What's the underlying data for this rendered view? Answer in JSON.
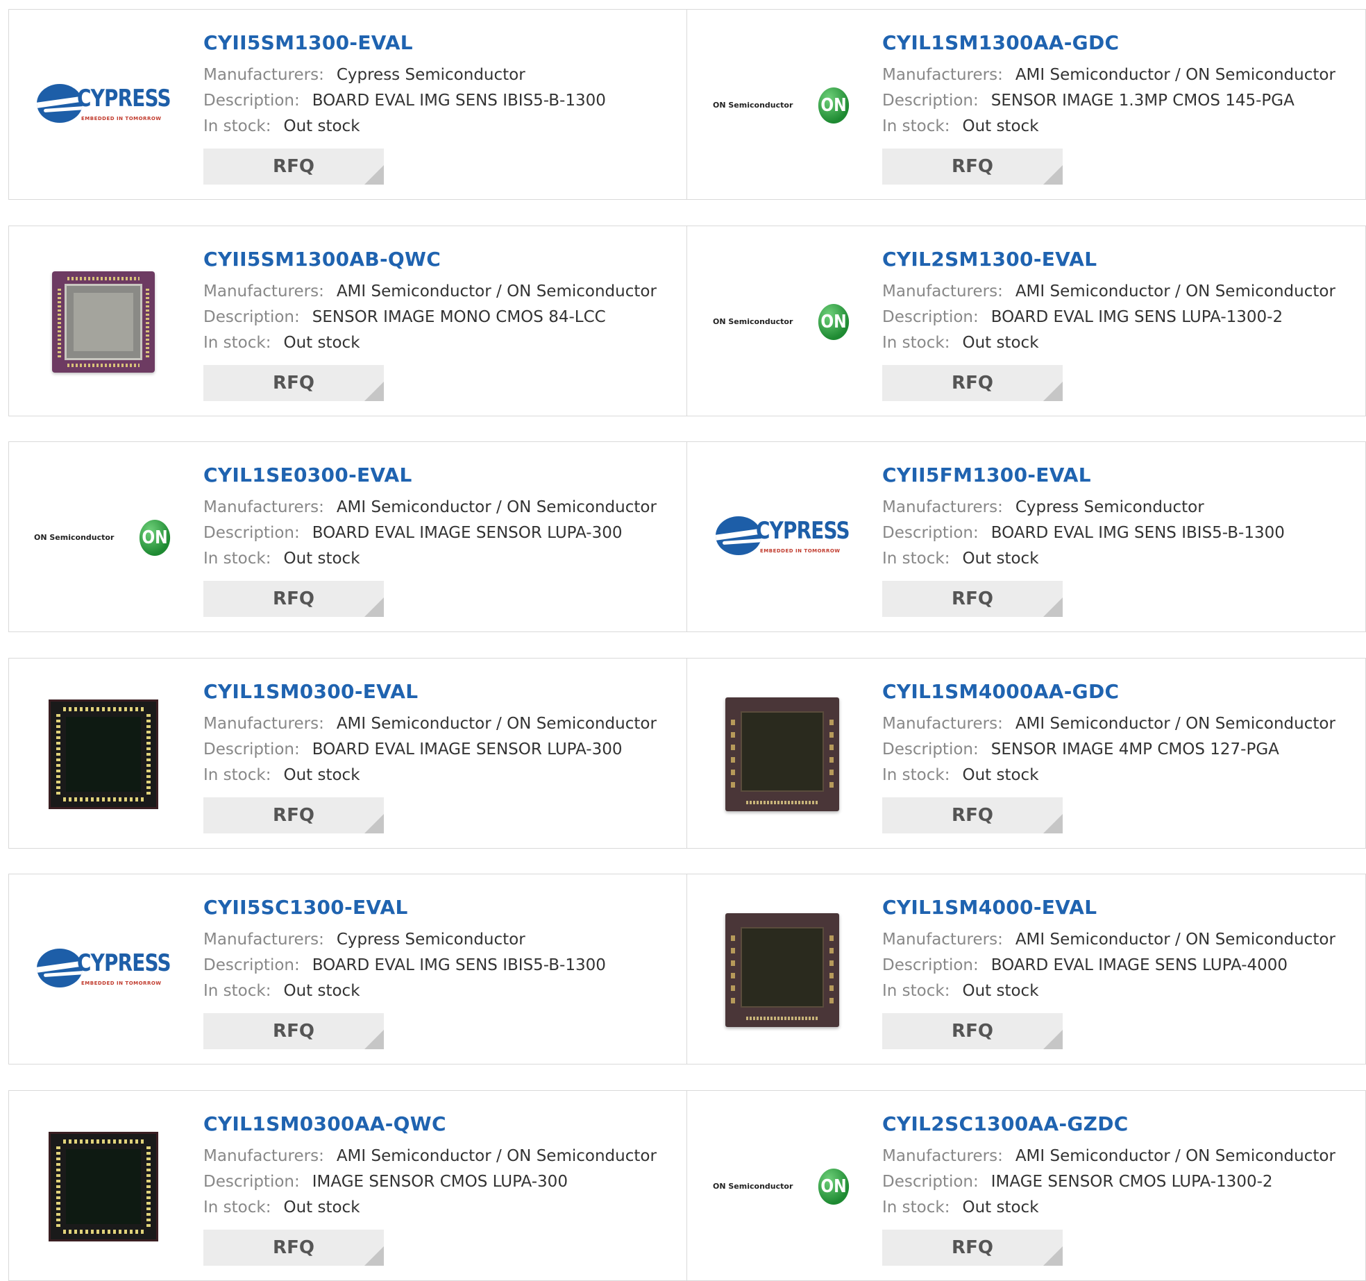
{
  "labels": {
    "manufacturers": "Manufacturers:",
    "description": "Description:",
    "in_stock": "In stock:",
    "rfq": "RFQ"
  },
  "products": [
    {
      "part": "CYII5SM1300-EVAL",
      "manufacturer": "Cypress Semiconductor",
      "description": "BOARD EVAL IMG SENS IBIS5-B-1300",
      "stock": "Out stock",
      "image": "cypress-logo"
    },
    {
      "part": "CYIL1SM1300AA-GDC",
      "manufacturer": "AMI Semiconductor / ON Semiconductor",
      "description": "SENSOR IMAGE 1.3MP CMOS 145-PGA",
      "stock": "Out stock",
      "image": "on-semiconductor-logo"
    },
    {
      "part": "CYII5SM1300AB-QWC",
      "manufacturer": "AMI Semiconductor / ON Semiconductor",
      "description": "SENSOR IMAGE MONO CMOS 84-LCC",
      "stock": "Out stock",
      "image": "purple-sensor-chip"
    },
    {
      "part": "CYIL2SM1300-EVAL",
      "manufacturer": "AMI Semiconductor / ON Semiconductor",
      "description": "BOARD EVAL IMG SENS LUPA-1300-2",
      "stock": "Out stock",
      "image": "on-semiconductor-logo"
    },
    {
      "part": "CYIL1SE0300-EVAL",
      "manufacturer": "AMI Semiconductor / ON Semiconductor",
      "description": "BOARD EVAL IMAGE SENSOR LUPA-300",
      "stock": "Out stock",
      "image": "on-semiconductor-logo"
    },
    {
      "part": "CYII5FM1300-EVAL",
      "manufacturer": "Cypress Semiconductor",
      "description": "BOARD EVAL IMG SENS IBIS5-B-1300",
      "stock": "Out stock",
      "image": "cypress-logo"
    },
    {
      "part": "CYIL1SM0300-EVAL",
      "manufacturer": "AMI Semiconductor / ON Semiconductor",
      "description": "BOARD EVAL IMAGE SENSOR LUPA-300",
      "stock": "Out stock",
      "image": "black-sensor-chip"
    },
    {
      "part": "CYIL1SM4000AA-GDC",
      "manufacturer": "AMI Semiconductor / ON Semiconductor",
      "description": "SENSOR IMAGE 4MP CMOS 127-PGA",
      "stock": "Out stock",
      "image": "brown-sensor-chip"
    },
    {
      "part": "CYII5SC1300-EVAL",
      "manufacturer": "Cypress Semiconductor",
      "description": "BOARD EVAL IMG SENS IBIS5-B-1300",
      "stock": "Out stock",
      "image": "cypress-logo"
    },
    {
      "part": "CYIL1SM4000-EVAL",
      "manufacturer": "AMI Semiconductor / ON Semiconductor",
      "description": "BOARD EVAL IMAGE SENS LUPA-4000",
      "stock": "Out stock",
      "image": "brown-sensor-chip"
    },
    {
      "part": "CYIL1SM0300AA-QWC",
      "manufacturer": "AMI Semiconductor / ON Semiconductor",
      "description": "IMAGE SENSOR CMOS LUPA-300",
      "stock": "Out stock",
      "image": "black-sensor-chip"
    },
    {
      "part": "CYIL2SC1300AA-GZDC",
      "manufacturer": "AMI Semiconductor / ON Semiconductor",
      "description": "IMAGE SENSOR CMOS LUPA-1300-2",
      "stock": "Out stock",
      "image": "on-semiconductor-logo"
    }
  ],
  "logos": {
    "cypress_word": "CYPRESS",
    "cypress_tagline": "EMBEDDED IN TOMORROW",
    "on_text": "ON Semiconductor",
    "on_mark": "ON"
  },
  "colors": {
    "part_link": "#1f63b0",
    "label_gray": "#888888",
    "value_text": "#333333",
    "rfq_bg": "#ececec",
    "border": "#d9d9d9"
  }
}
